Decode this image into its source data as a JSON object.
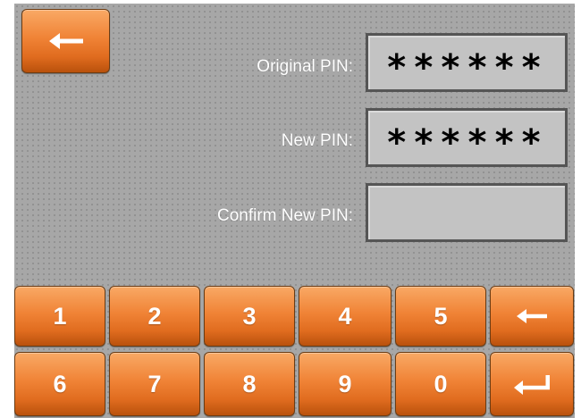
{
  "form": {
    "original_pin": {
      "label": "Original PIN:",
      "value": "******"
    },
    "new_pin": {
      "label": "New PIN:",
      "value": "******"
    },
    "confirm_pin": {
      "label": "Confirm New PIN:",
      "value": ""
    }
  },
  "keypad": {
    "row1": [
      "1",
      "2",
      "3",
      "4",
      "5"
    ],
    "row2": [
      "6",
      "7",
      "8",
      "9",
      "0"
    ]
  },
  "icons": {
    "back": "left-arrow-icon",
    "backspace": "left-arrow-icon",
    "enter": "enter-return-icon"
  },
  "colors": {
    "key_orange": "#f08336",
    "panel_gray": "#a7a7a7",
    "field_gray": "#c3c3c3",
    "text_white": "#ffffff"
  }
}
